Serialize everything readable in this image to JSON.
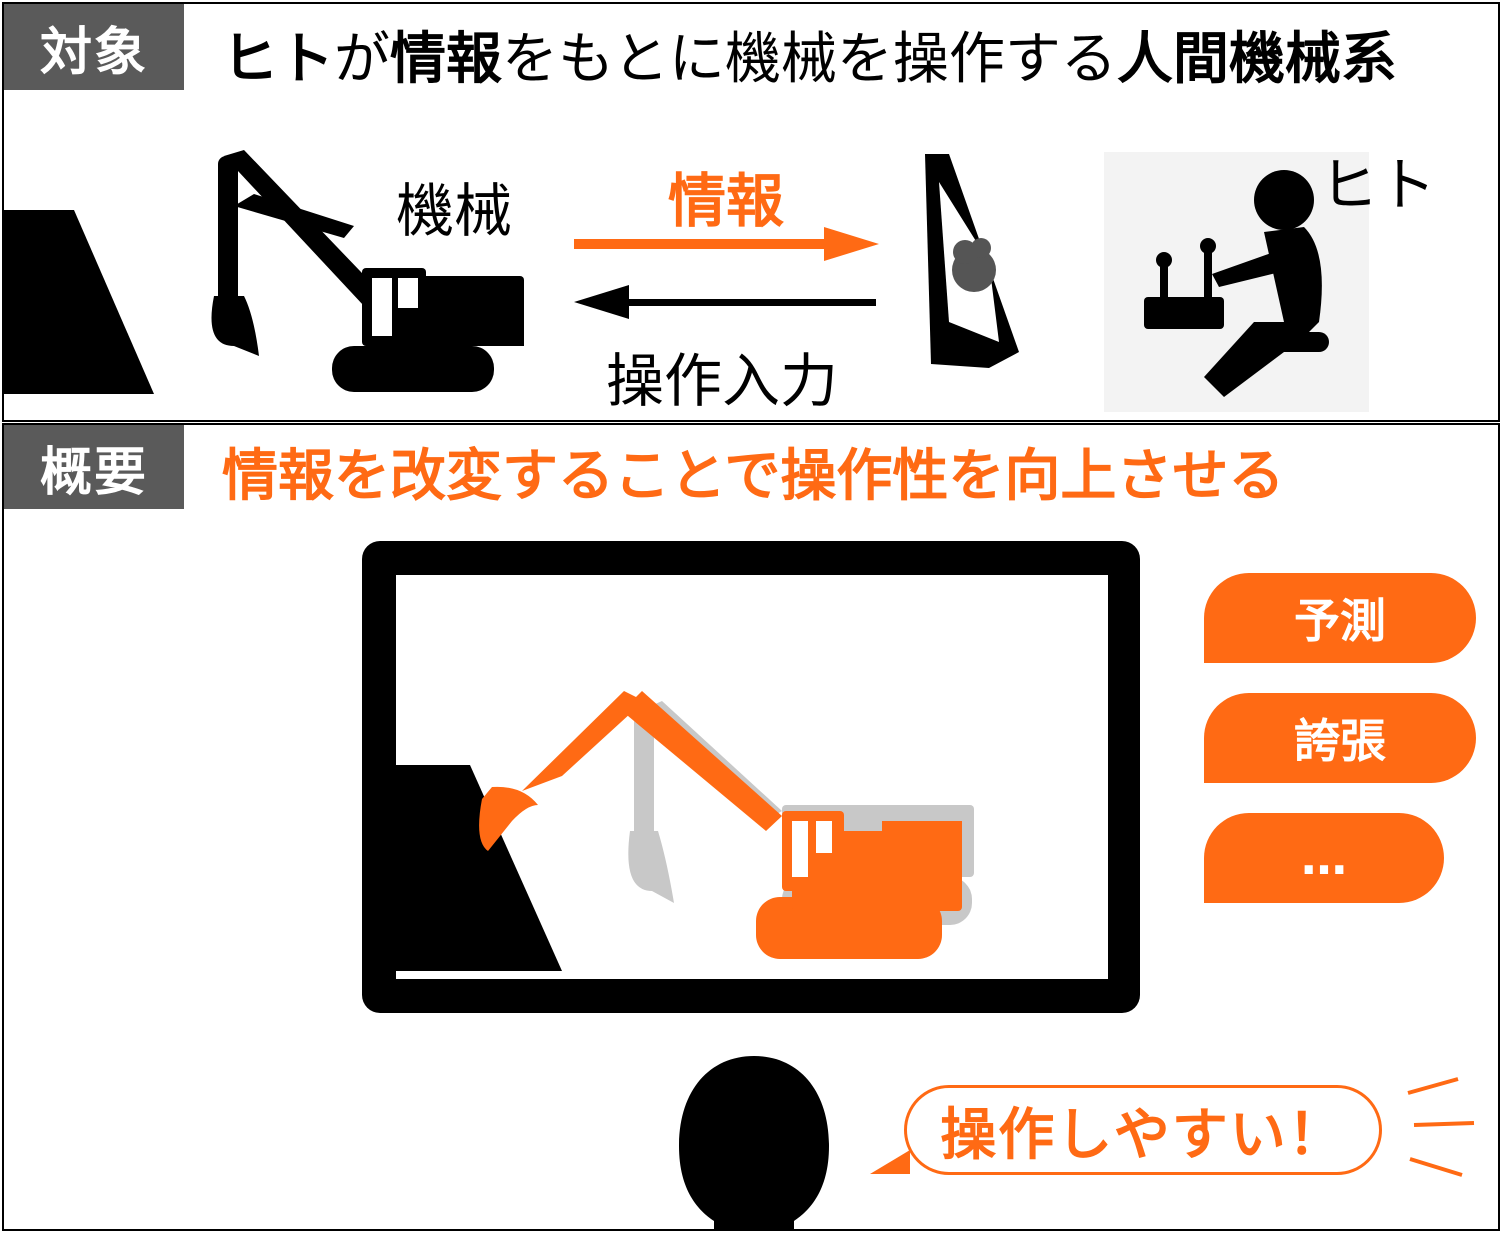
{
  "colors": {
    "accent": "#ff6a14",
    "tag_bg": "#5a5a5a",
    "ghost": "#c8c8c8",
    "black": "#000000"
  },
  "top": {
    "tag": "対象",
    "title": {
      "p1": "ヒト",
      "p2": "が",
      "p3": "情報",
      "p4": "をもとに機械を操作する",
      "p5": "人間機械系"
    },
    "label_machine": "機械",
    "label_info": "情報",
    "label_input": "操作入力",
    "label_human": "ヒト",
    "icons": [
      "cliff-icon",
      "excavator-icon",
      "monitor-icon",
      "operator-icon"
    ]
  },
  "bottom": {
    "tag": "概要",
    "title": "情報を改変することで操作性を向上させる",
    "methods": [
      "予測",
      "誇張",
      "…"
    ],
    "speech": "操作しやすい！",
    "icons": [
      "monitor-icon",
      "excavator-icon",
      "person-head-icon",
      "emphasis-lines-icon"
    ]
  }
}
